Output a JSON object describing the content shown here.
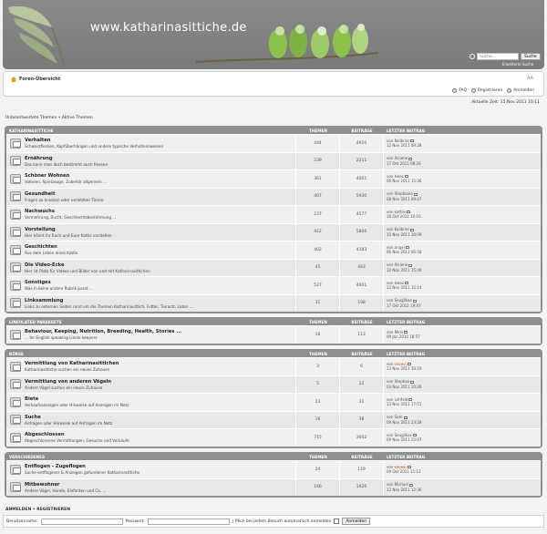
{
  "header": {
    "site_name": "www.katharinasittiche.de",
    "search_placeholder": "Suche…",
    "search_button": "Suche",
    "advanced_search": "Erweiterte Suche"
  },
  "navbar": {
    "index_label": "Foren-Übersicht",
    "font_toggle": "A⁠A",
    "faq": "FAQ",
    "register": "Registrieren",
    "login": "Anmelden"
  },
  "time_info": "Aktuelle Zeit: 15 Nov 2011 10:11",
  "links_line": "Unbeantwortete Themen • Aktive Themen",
  "column_labels": {
    "topics": "THEMEN",
    "posts": "BEITRÄGE",
    "last": "LETZTER BEITRAG"
  },
  "categories": [
    {
      "title": "KATHARINASITTICHE",
      "forums": [
        {
          "name": "Verhalten",
          "desc": "Schwarzflecken, Kopfüberhängen und andere typische Verhaltensweisen",
          "topics": "444",
          "posts": "4910",
          "by": "Kolibri​er",
          "date": "12 Nov 2011 09:28"
        },
        {
          "name": "Ernährung",
          "desc": "Das kann man doch bestimmt auch fressen",
          "topics": "239",
          "posts": "2211",
          "by": "Alciene",
          "date": "17 Okt 2011 08:26"
        },
        {
          "name": "Schöner Wohnen",
          "desc": "Volieren, Spielzeuge, Zubehör allgemein ...",
          "topics": "361",
          "posts": "4001",
          "by": "kwax",
          "date": "06 Nov 2011 15:36"
        },
        {
          "name": "Gesundheit",
          "desc": "Fragen zu kranken oder verletzten Tieren",
          "topics": "407",
          "posts": "5930",
          "by": "Stephanie",
          "date": "08 Nov 2011 09:47"
        },
        {
          "name": "Nachwuchs",
          "desc": "Vermehrung, Zucht, Geschlechtsbestimmung ...",
          "topics": "237",
          "posts": "4577",
          "by": "kathie",
          "date": "16 Okt 2011 10:16"
        },
        {
          "name": "Vorstellung",
          "desc": "Hier könnt ihr Euch und Eure Kattis vorstellen",
          "topics": "412",
          "posts": "5806",
          "by": "Kolibri​er",
          "date": "15 Nov 2011 10:09"
        },
        {
          "name": "Geschichten",
          "desc": "Aus dem Leben eines Kattis",
          "topics": "402",
          "posts": "4183",
          "by": "angel",
          "date": "06 Nov 2011 06:58"
        },
        {
          "name": "Die Video-Ecke",
          "desc": "Hier ist Platz für Videos und Bilder von und mit Katharinasittichen",
          "topics": "45",
          "posts": "443",
          "by": "Alciene",
          "date": "10 Nov 2011 15:49"
        },
        {
          "name": "Sonstiges",
          "desc": "Was in keine andere Rubrik passt ...",
          "topics": "527",
          "posts": "4601",
          "by": "kwax",
          "date": "12 Nov 2011 15:14"
        },
        {
          "name": "Linksammlung",
          "desc": "Links zu externen Seiten rund um die Themen Katharinasittich, Futter, Tierarzt, Labor ...",
          "topics": "31",
          "posts": "198",
          "by": "Seuglikas",
          "date": "17 Okt 2011 19:47"
        }
      ]
    },
    {
      "title": "LINEOLATED PARAKEETS",
      "forums": [
        {
          "name": "Behaviour, Keeping, Nutrition, Breeding, Health, Stories ...",
          "desc": "... for English speaking Linnie keepers",
          "topics": "16",
          "posts": "113",
          "by": "Mimi",
          "date": "09 Jan 2010 18:57"
        }
      ]
    },
    {
      "title": "BÖRSE",
      "forums": [
        {
          "name": "Vermittlung von Katharinasittichen",
          "desc": "Katharinasittiche suchen ein neues Zuhause",
          "topics": "3",
          "posts": "6",
          "by": "snoevi",
          "date": "13 Nov 2011 16:19",
          "red": true
        },
        {
          "name": "Vermittlung von anderen Vögeln",
          "desc": "Andere Vögel suchen ein neues Zuhause",
          "topics": "5",
          "posts": "22",
          "by": "Stephan",
          "date": "03 Nov 2011 10:26"
        },
        {
          "name": "Biete",
          "desc": "Verkaufsanzeigen oder Hinweise auf Anzeigen im Netz",
          "topics": "23",
          "posts": "31",
          "by": "Lehfeld",
          "date": "13 Nov 2011 17:51"
        },
        {
          "name": "Suche",
          "desc": "Anfragen oder Hinweise auf Anfragen im Netz",
          "topics": "16",
          "posts": "38",
          "by": "Sam",
          "date": "09 Nov 2011 23:28"
        },
        {
          "name": "Abgeschlossen",
          "desc": "Abgeschlossene Vermittlungen, Gesuche und Verkäufe",
          "topics": "715",
          "posts": "3602",
          "by": "Seuglikas",
          "date": "09 Nov 2011 23:07"
        }
      ]
    },
    {
      "title": "VERSCHIEDENES",
      "forums": [
        {
          "name": "Entflogen - Zugeflogen",
          "desc": "Suche entflogener & Anzeigen gefundener Katharinasittiche",
          "topics": "24",
          "posts": "119",
          "by": "snoevi",
          "date": "09 Okt 2011 11:12",
          "red": true
        },
        {
          "name": "Mitbewohner",
          "desc": "Andere Vögel, Hunde, Elefanten und Co. ...",
          "topics": "166",
          "posts": "1926",
          "by": "Michael",
          "date": "12 Nov 2011 12:36"
        }
      ]
    }
  ],
  "footer": {
    "links": "ANMELDEN • REGISTRIEREN",
    "username_label": "Benutzername:",
    "password_label": "Passwort:",
    "autologin_label": "| Mich bei jedem Besuch automatisch anmelden",
    "login_button": "Anmelden"
  }
}
